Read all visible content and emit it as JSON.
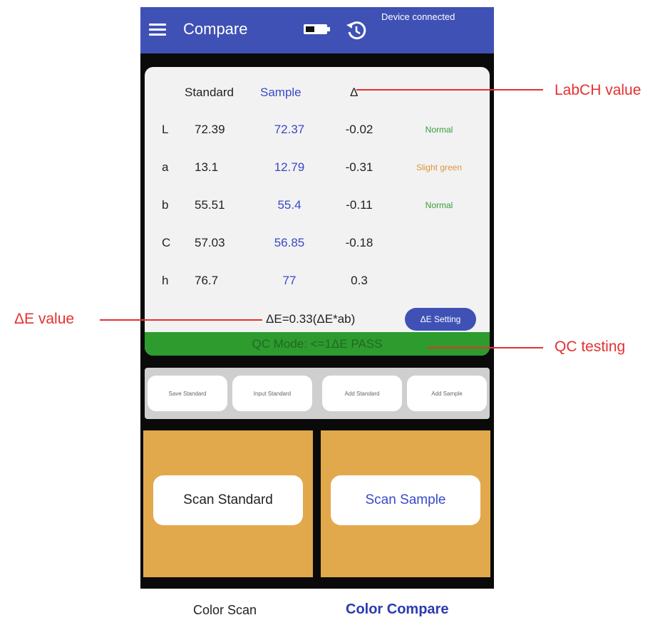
{
  "app": {
    "title": "Compare",
    "connection_status": "Device connected"
  },
  "table": {
    "headers": {
      "standard": "Standard",
      "sample": "Sample",
      "delta": "Δ"
    },
    "rows": [
      {
        "label": "L",
        "standard": "72.39",
        "sample": "72.37",
        "delta": "-0.02",
        "evaluation": "Normal",
        "eval_color": "#3a9c3a"
      },
      {
        "label": "a",
        "standard": "13.1",
        "sample": "12.79",
        "delta": "-0.31",
        "evaluation": "Slight green",
        "eval_color": "#e0943a"
      },
      {
        "label": "b",
        "standard": "55.51",
        "sample": "55.4",
        "delta": "-0.11",
        "evaluation": "Normal",
        "eval_color": "#3a9c3a"
      },
      {
        "label": "C",
        "standard": "57.03",
        "sample": "56.85",
        "delta": "-0.18",
        "evaluation": ""
      },
      {
        "label": "h",
        "standard": "76.7",
        "sample": "77",
        "delta": "0.3",
        "evaluation": ""
      }
    ]
  },
  "delta_e": {
    "text": "ΔE=0.33(ΔE*ab)",
    "setting_button": "ΔE Setting"
  },
  "qc": {
    "status_text": "QC Mode: <=1ΔE  PASS",
    "bar_color": "#2e9b2e"
  },
  "actions": {
    "save_standard": "Save Standard",
    "input_standard": "Input Standard",
    "add_standard": "Add Standard",
    "add_sample": "Add Sample"
  },
  "scan": {
    "standard": "Scan Standard",
    "sample": "Scan Sample"
  },
  "bottom_nav": {
    "color_scan": "Color Scan",
    "color_compare": "Color Compare"
  },
  "annotations": {
    "labch": "LabCH value",
    "delta_e": "ΔE value",
    "qc": "QC testing"
  },
  "colors": {
    "appbar": "#3f51b5",
    "panel": "#e2a84c",
    "annotation": "#e53030"
  }
}
